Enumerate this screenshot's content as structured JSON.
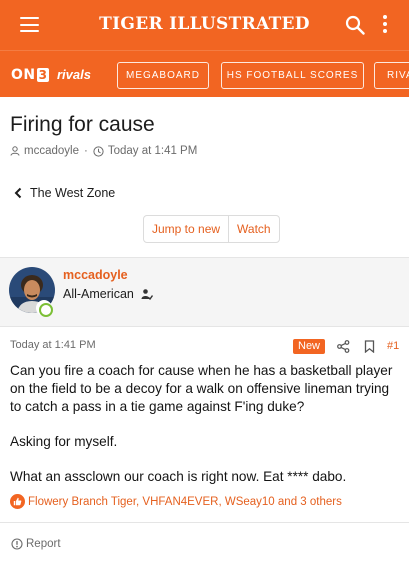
{
  "colors": {
    "brand": "#f26522",
    "link": "#e5601f",
    "online": "#7cbf36"
  },
  "header": {
    "title": "TIGER ILLUSTRATED",
    "menu_icon": "hamburger-icon",
    "search_icon": "search-icon",
    "more_icon": "kebab-icon"
  },
  "nav": {
    "on3_text": "ON",
    "on3_num": "3",
    "rivals_text": "rivals",
    "pills": [
      "MEGABOARD",
      "HS FOOTBALL SCORES",
      "RIVA"
    ]
  },
  "thread": {
    "title": "Firing for cause",
    "author": "mccadoyle",
    "time": "Today at 1:41 PM",
    "breadcrumb": "The West Zone",
    "jump_label": "Jump to new",
    "watch_label": "Watch"
  },
  "user": {
    "name": "mccadoyle",
    "title": "All-American"
  },
  "post": {
    "time": "Today at 1:41 PM",
    "badge": "New",
    "number": "#1",
    "paragraphs": [
      "Can you fire a coach for cause when he has a basketball player on the field to be a decoy for a walk on offensive lineman trying to catch a pass in a tie game against F'ing duke?",
      "Asking for myself.",
      "What an assclown our coach is right now. Eat **** dabo."
    ],
    "reactions": "Flowery Branch Tiger, VHFAN4EVER, WSeay10 and 3 others",
    "report_label": "Report"
  }
}
